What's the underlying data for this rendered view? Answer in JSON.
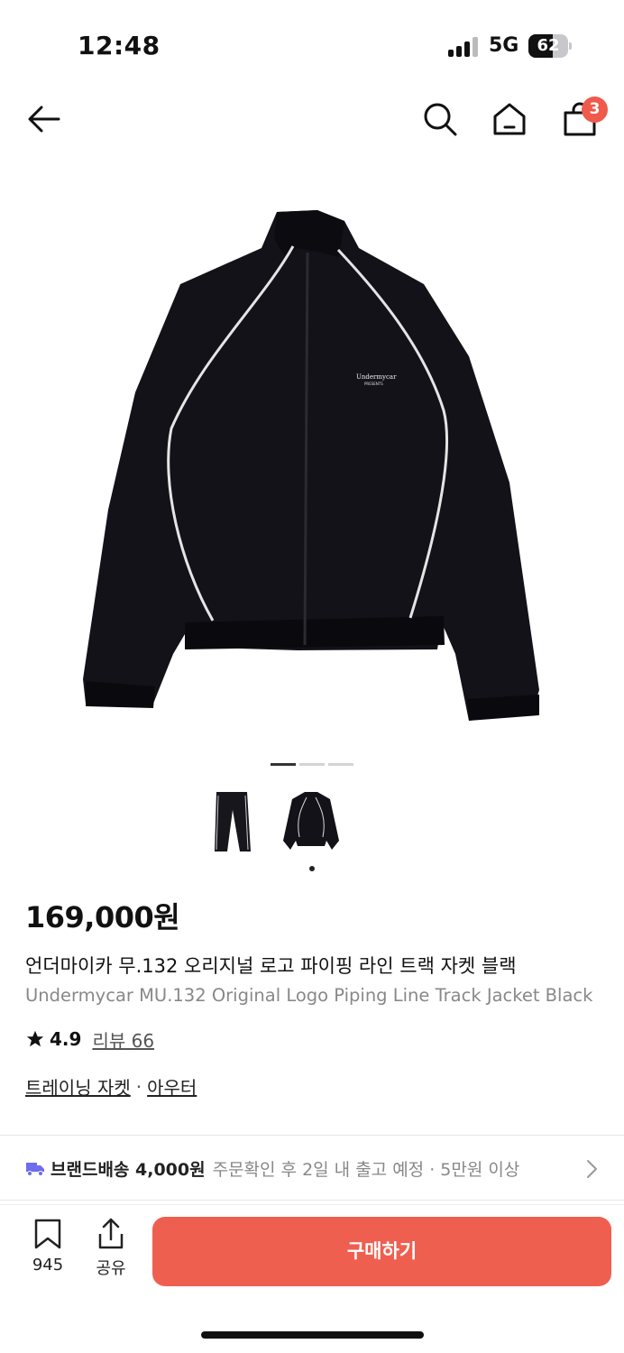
{
  "status_bar": {
    "time": "12:48",
    "network": "5G",
    "battery": "62",
    "battery_level": 0.62
  },
  "nav": {
    "cart_count": "3"
  },
  "gallery": {
    "page_count": 3,
    "current_page": 1,
    "thumbnails": [
      "track-pants",
      "track-jacket"
    ],
    "selected_thumbnail": 2
  },
  "jacket_logo": {
    "line1": "Undermycar",
    "line2": "PRESENTS"
  },
  "product": {
    "price": "169,000원",
    "name_ko": "언더마이카 무.132 오리지널 로고 파이핑 라인 트랙 자켓 블랙",
    "name_en": "Undermycar MU.132 Original Logo Piping Line Track Jacket Black",
    "rating": "4.9",
    "review_label": "리뷰 66",
    "category_1": "트레이닝 자켓",
    "category_sep": "·",
    "category_2": "아우터"
  },
  "shipping": {
    "main": "브랜드배송 4,000원",
    "sub": "주문확인 후 2일 내 출고 예정 · 5만원 이상"
  },
  "bottom_bar": {
    "bookmark_count": "945",
    "share_label": "공유",
    "buy_label": "구매하기"
  },
  "colors": {
    "accent": "#ef5f50",
    "badge": "#ef5a4b",
    "truck": "#6f6cf0"
  }
}
